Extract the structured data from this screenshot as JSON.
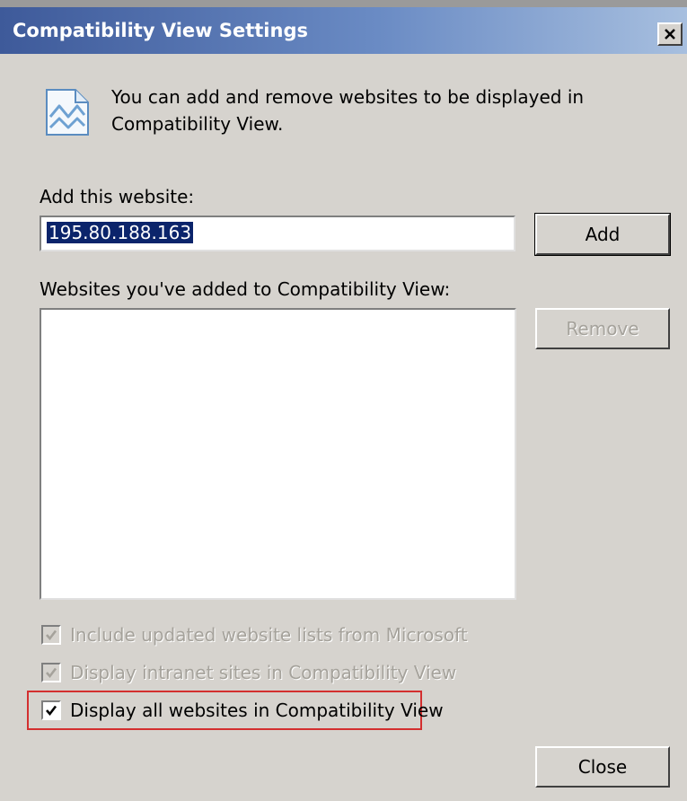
{
  "window": {
    "title": "Compatibility View Settings",
    "close_glyph": "×",
    "titlebar_colors": [
      "#3e5a9a",
      "#a7bfdf"
    ]
  },
  "intro": {
    "icon": "compatibility-view-icon",
    "text_line1": "You can add and remove websites to be displayed in",
    "text_line2": "Compatibility View."
  },
  "add_section": {
    "label": "Add this website:",
    "input_value": "195.80.188.163",
    "add_button": "Add"
  },
  "list_section": {
    "label": "Websites you've added to Compatibility View:",
    "items": [],
    "remove_button": "Remove"
  },
  "options": [
    {
      "label": "Include updated website lists from Microsoft",
      "checked": true,
      "enabled": false
    },
    {
      "label": "Display intranet sites in Compatibility View",
      "checked": true,
      "enabled": false
    },
    {
      "label": "Display all websites in Compatibility View",
      "checked": true,
      "enabled": true
    }
  ],
  "footer": {
    "close_button": "Close"
  },
  "highlight_color": "#d32f2f"
}
